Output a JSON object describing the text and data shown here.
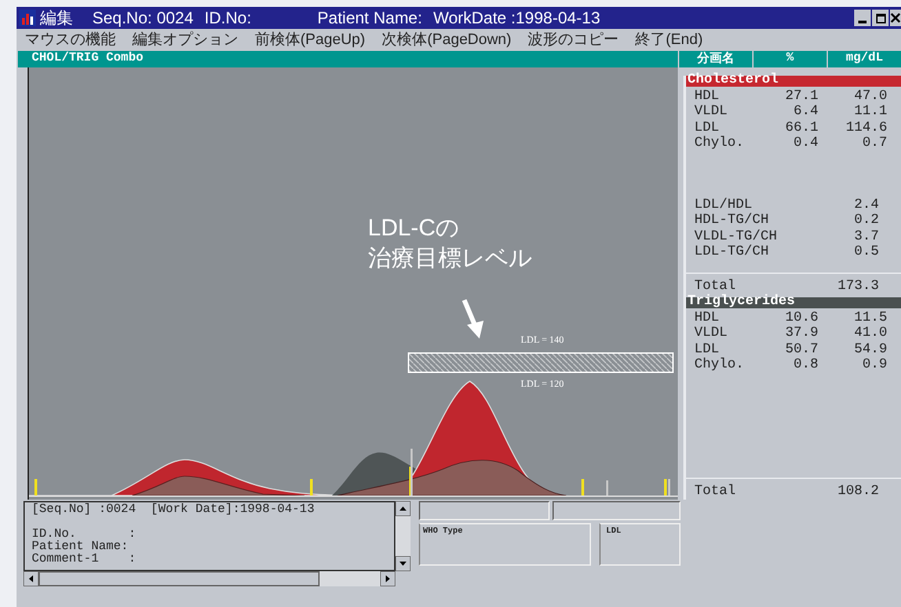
{
  "window": {
    "title": "編集",
    "fields": [
      "Seq.No: 0024",
      "ID.No:",
      "Patient Name:",
      "WorkDate :1998-04-13"
    ]
  },
  "menu": [
    "マウスの機能",
    "編集オプション",
    "前検体(PageUp)",
    "次検体(PageDown)",
    "波形のコピー",
    "終了(End)"
  ],
  "chart": {
    "title": "CHOL/TRIG Combo",
    "annotation": [
      "LDL-Cの",
      "治療目標レベル"
    ],
    "band_labels": [
      "LDL = 140",
      "LDL = 120"
    ]
  },
  "results": {
    "columns": [
      "分画名",
      "%",
      "mg/dL"
    ],
    "sections": [
      {
        "title": "Cholesterol",
        "color": "#c62830",
        "rows": [
          {
            "name": "HDL",
            "pct": "27.1",
            "value": "47.0"
          },
          {
            "name": "VLDL",
            "pct": "6.4",
            "value": "11.1"
          },
          {
            "name": "LDL",
            "pct": "66.1",
            "value": "114.6"
          },
          {
            "name": "Chylo.",
            "pct": "0.4",
            "value": "0.7"
          }
        ],
        "ratios": [
          {
            "name": "LDL/HDL",
            "value": "2.4"
          },
          {
            "name": "HDL-TG/CH",
            "value": "0.2"
          },
          {
            "name": "VLDL-TG/CH",
            "value": "3.7"
          },
          {
            "name": "LDL-TG/CH",
            "value": "0.5"
          }
        ],
        "total": {
          "label": "Total",
          "value": "173.3"
        }
      },
      {
        "title": "Triglycerides",
        "color": "#4a5050",
        "rows": [
          {
            "name": "HDL",
            "pct": "10.6",
            "value": "11.5"
          },
          {
            "name": "VLDL",
            "pct": "37.9",
            "value": "41.0"
          },
          {
            "name": "LDL",
            "pct": "50.7",
            "value": "54.9"
          },
          {
            "name": "Chylo.",
            "pct": "0.8",
            "value": "0.9"
          }
        ],
        "total": {
          "label": "Total",
          "value": "108.2"
        }
      }
    ]
  },
  "info": {
    "lines": [
      "[Seq.No] :0024  [Work Date]:1998-04-13",
      "ID.No.       :",
      "Patient Name:",
      "Comment-1    :"
    ]
  },
  "type_boxes": [
    "WHO Type",
    "LDL"
  ]
}
